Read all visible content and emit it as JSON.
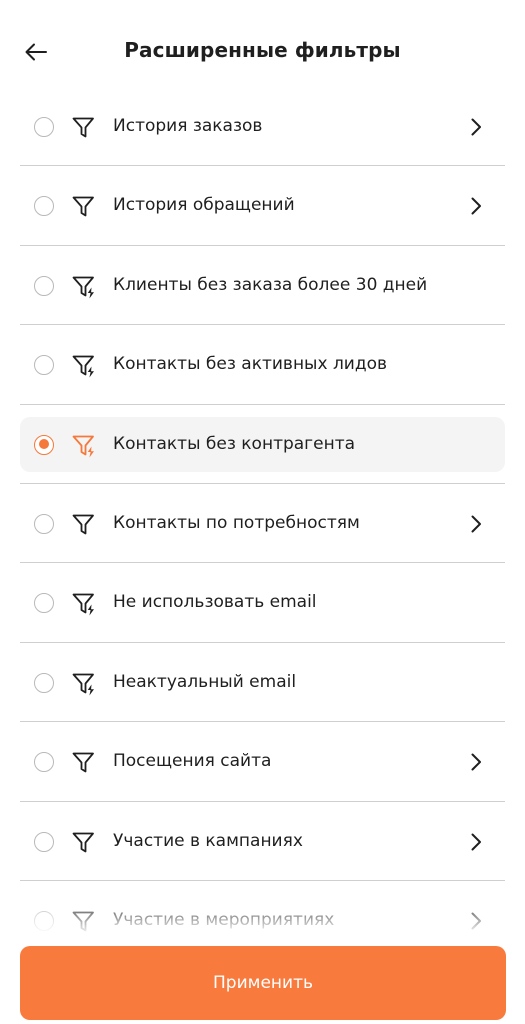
{
  "header": {
    "title": "Расширенные фильтры"
  },
  "icons": {
    "back": "arrow-left-icon",
    "filter": "funnel-icon",
    "smart_filter": "funnel-lightning-icon",
    "chevron": "chevron-right-icon"
  },
  "colors": {
    "accent": "#f5793b",
    "button": "#f97a3d",
    "divider": "#cfcfcf",
    "highlight": "#f4f4f4",
    "radio_border": "#b9b9b9"
  },
  "filters": [
    {
      "label": "История заказов",
      "icon": "funnel-icon",
      "has_chevron": true,
      "selected": false
    },
    {
      "label": "История обращений",
      "icon": "funnel-icon",
      "has_chevron": true,
      "selected": false
    },
    {
      "label": "Клиенты без заказа более 30 дней",
      "icon": "funnel-lightning-icon",
      "has_chevron": false,
      "selected": false
    },
    {
      "label": "Контакты без активных лидов",
      "icon": "funnel-lightning-icon",
      "has_chevron": false,
      "selected": false
    },
    {
      "label": "Контакты без контрагента",
      "icon": "funnel-lightning-icon",
      "has_chevron": false,
      "selected": true
    },
    {
      "label": "Контакты по потребностям",
      "icon": "funnel-icon",
      "has_chevron": true,
      "selected": false
    },
    {
      "label": "Не использовать email",
      "icon": "funnel-lightning-icon",
      "has_chevron": false,
      "selected": false
    },
    {
      "label": "Неактуальный email",
      "icon": "funnel-lightning-icon",
      "has_chevron": false,
      "selected": false
    },
    {
      "label": "Посещения сайта",
      "icon": "funnel-icon",
      "has_chevron": true,
      "selected": false
    },
    {
      "label": "Участие в кампаниях",
      "icon": "funnel-icon",
      "has_chevron": true,
      "selected": false
    },
    {
      "label": "Участие в мероприятиях",
      "icon": "funnel-icon",
      "has_chevron": true,
      "selected": false
    }
  ],
  "footer": {
    "apply_label": "Применить"
  }
}
